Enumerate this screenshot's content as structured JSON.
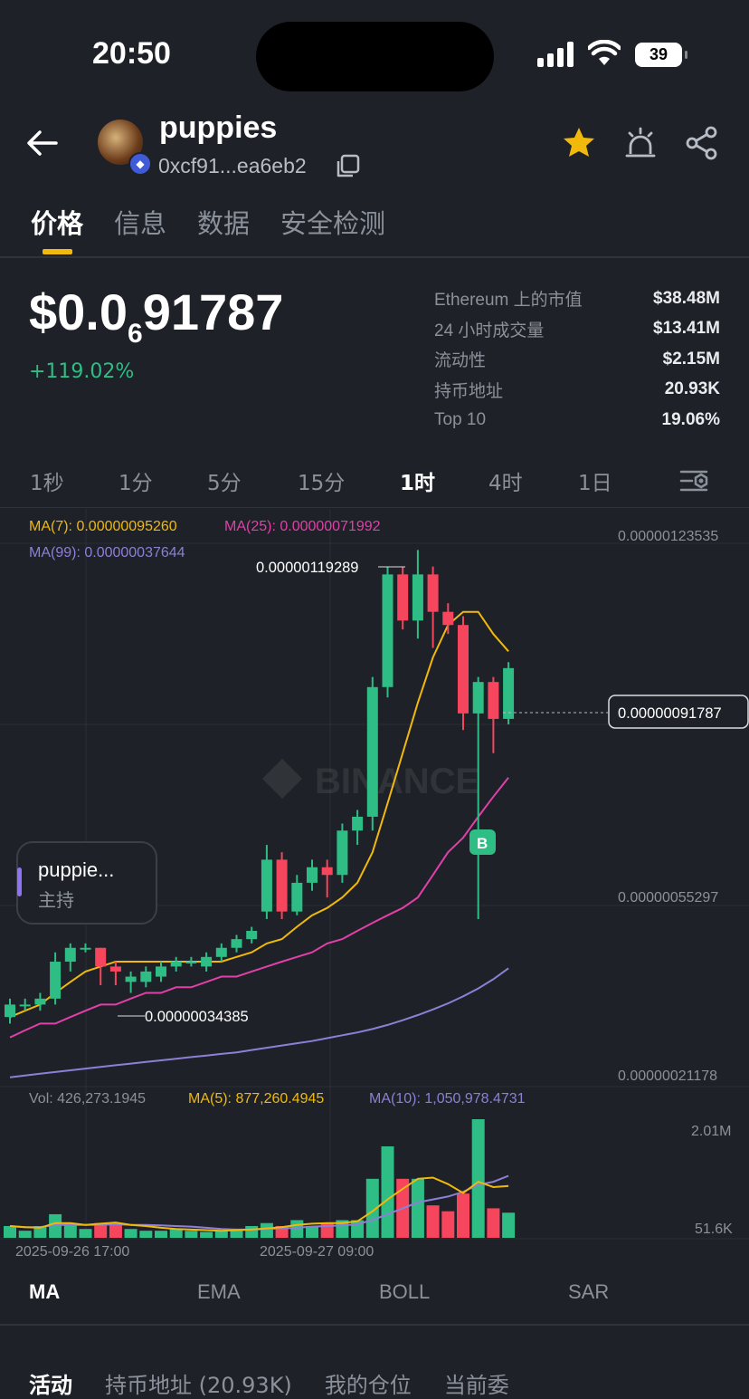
{
  "status_bar": {
    "time": "20:50",
    "battery": "39"
  },
  "header": {
    "token_name": "puppies",
    "token_address": "0xcf91...ea6eb2",
    "icons": [
      "back-arrow-icon",
      "ethereum-icon",
      "copy-icon",
      "star-icon",
      "alarm-icon",
      "share-icon"
    ],
    "star_color": "#f0b90b"
  },
  "tabs": [
    {
      "label": "价格",
      "active": true
    },
    {
      "label": "信息",
      "active": false
    },
    {
      "label": "数据",
      "active": false
    },
    {
      "label": "安全检测",
      "active": false
    }
  ],
  "price": {
    "prefix": "$0.0",
    "zeros": "6",
    "digits": "91787",
    "change": "+119.02%",
    "change_color": "#2ebd85"
  },
  "stats": [
    {
      "label": "Ethereum 上的市值",
      "value": "$38.48M"
    },
    {
      "label": "24 小时成交量",
      "value": "$13.41M"
    },
    {
      "label": "流动性",
      "value": "$2.15M"
    },
    {
      "label": "持币地址",
      "value": "20.93K"
    },
    {
      "label": "Top 10",
      "value": "19.06%"
    }
  ],
  "timeframes": [
    {
      "label": "1秒",
      "active": false
    },
    {
      "label": "1分",
      "active": false
    },
    {
      "label": "5分",
      "active": false
    },
    {
      "label": "15分",
      "active": false
    },
    {
      "label": "1时",
      "active": true
    },
    {
      "label": "4时",
      "active": false
    },
    {
      "label": "1日",
      "active": false
    }
  ],
  "chart_labels": {
    "ma7": "MA(7): 0.00000095260",
    "ma25": "MA(25): 0.00000071992",
    "ma99": "MA(99): 0.00000037644",
    "y_top": "0.00000123535",
    "y_mid": "0.00000055297",
    "y_bot": "0.00000021178",
    "current_price": "0.00000091787",
    "high_label": "0.00000119289",
    "low_label": "0.00000034385",
    "watermark": "BINANCE",
    "buy_marker": "B",
    "vol": "Vol: 426,273.1945",
    "vol_ma5": "MA(5): 877,260.4945",
    "vol_ma10": "MA(10): 1,050,978.4731",
    "vol_top": "2.01M",
    "vol_bot": "51.6K",
    "x1": "2025-09-26 17:00",
    "x2": "2025-09-27 09:00"
  },
  "host_card": {
    "title": "puppie...",
    "subtitle": "主持"
  },
  "indicators": [
    {
      "label": "MA",
      "active": true
    },
    {
      "label": "EMA",
      "active": false
    },
    {
      "label": "BOLL",
      "active": false
    },
    {
      "label": "SAR",
      "active": false
    }
  ],
  "bottom_tabs": [
    {
      "label": "活动",
      "active": true
    },
    {
      "label": "持币地址 (20.93K)",
      "active": false
    },
    {
      "label": "我的仓位",
      "active": false
    },
    {
      "label": "当前委",
      "active": false
    }
  ],
  "colors": {
    "up": "#2ebd85",
    "down": "#f6465d",
    "ma7": "#f0b90b",
    "ma25": "#e040a8",
    "ma99": "#8e7fd6"
  },
  "chart_data": {
    "type": "candlestick",
    "interval": "1h",
    "y_axis_labels": [
      1.23535e-06,
      5.5297e-07,
      2.1178e-07
    ],
    "candles": [
      [
        2.9e-07,
        3.1e-07,
        2.8e-07,
        3.2e-07
      ],
      [
        3.1e-07,
        3.1e-07,
        3e-07,
        3.2e-07
      ],
      [
        3.1e-07,
        3.2e-07,
        3e-07,
        3.3e-07
      ],
      [
        3.2e-07,
        3.9e-07,
        3.1e-07,
        4.1e-07
      ],
      [
        3.9e-07,
        4.2e-07,
        3.7e-07,
        4.3e-07
      ],
      [
        4.2e-07,
        4.2e-07,
        4.1e-07,
        4.3e-07
      ],
      [
        4.2e-07,
        3.8e-07,
        3.4385e-07,
        4.2e-07
      ],
      [
        3.8e-07,
        3.7e-07,
        3.4385e-07,
        3.9e-07
      ],
      [
        3.5e-07,
        3.6e-07,
        3.3e-07,
        3.7e-07
      ],
      [
        3.5e-07,
        3.7e-07,
        3.4e-07,
        3.8e-07
      ],
      [
        3.6e-07,
        3.8e-07,
        3.5e-07,
        3.9e-07
      ],
      [
        3.8e-07,
        3.9e-07,
        3.7e-07,
        4e-07
      ],
      [
        3.9e-07,
        3.9e-07,
        3.8e-07,
        4e-07
      ],
      [
        3.8e-07,
        4e-07,
        3.7e-07,
        4.1e-07
      ],
      [
        4e-07,
        4.2e-07,
        3.9e-07,
        4.3e-07
      ],
      [
        4.2e-07,
        4.4e-07,
        4.1e-07,
        4.5e-07
      ],
      [
        4.4e-07,
        4.6e-07,
        4.3e-07,
        4.7e-07
      ],
      [
        5.1e-07,
        6e-07,
        4.9e-07,
        6.2e-07
      ],
      [
        6e-07,
        5.1e-07,
        4.9e-07,
        6.1e-07
      ],
      [
        5.1e-07,
        5.7e-07,
        5e-07,
        5.8e-07
      ],
      [
        5.7e-07,
        5.9e-07,
        5.6e-07,
        6e-07
      ],
      [
        5.9e-07,
        5.8e-07,
        5.5e-07,
        6e-07
      ],
      [
        5.8e-07,
        6.4e-07,
        5.7e-07,
        6.5e-07
      ],
      [
        6.4e-07,
        6.6e-07,
        6.2e-07,
        6.7e-07
      ],
      [
        6.6e-07,
        8.8e-07,
        6.4e-07,
        9e-07
      ],
      [
        8.8e-07,
        1.13e-06,
        8.6e-07,
        1.15e-06
      ],
      [
        1.13e-06,
        1.02e-06,
        1e-06,
        1.15e-06
      ],
      [
        1.02e-06,
        1.13e-06,
        9.8e-07,
        1.19289e-06
      ],
      [
        1.13e-06,
        1.04e-06,
        9.6e-07,
        1.15e-06
      ],
      [
        1.04e-06,
        1.01e-06,
        9.9e-07,
        1.06e-06
      ],
      [
        1.01e-06,
        8.3e-07,
        8e-07,
        1.03e-06
      ],
      [
        8.3e-07,
        8.9e-07,
        4.9e-07,
        9e-07
      ],
      [
        8.9e-07,
        8.2e-07,
        7.6e-07,
        9e-07
      ],
      [
        8.2e-07,
        9.1787e-07,
        8.1e-07,
        9.3e-07
      ]
    ],
    "ma7": [
      2.9e-07,
      3e-07,
      3.1e-07,
      3.3e-07,
      3.5e-07,
      3.7e-07,
      3.8e-07,
      3.9e-07,
      3.9e-07,
      3.9e-07,
      3.9e-07,
      3.9e-07,
      3.9e-07,
      3.9e-07,
      3.9e-07,
      4e-07,
      4.1e-07,
      4.3e-07,
      4.4e-07,
      4.7e-07,
      5e-07,
      5.2e-07,
      5.5e-07,
      5.7e-07,
      6.1e-07,
      6.8e-07,
      7.6e-07,
      8.5e-07,
      9.4e-07,
      1.01e-06,
      1.04e-06,
      1.04e-06,
      9.9e-07,
      9.526e-07
    ],
    "ma25": [
      2.6e-07,
      2.7e-07,
      2.8e-07,
      2.8e-07,
      2.9e-07,
      3e-07,
      3.1e-07,
      3.1e-07,
      3.2e-07,
      3.3e-07,
      3.3e-07,
      3.4e-07,
      3.4e-07,
      3.5e-07,
      3.6e-07,
      3.6e-07,
      3.7e-07,
      3.8e-07,
      3.9e-07,
      4e-07,
      4.1e-07,
      4.3e-07,
      4.4e-07,
      4.6e-07,
      4.8e-07,
      5e-07,
      5.2e-07,
      5.5e-07,
      5.8e-07,
      6.1e-07,
      6.3e-07,
      6.6e-07,
      6.9e-07,
      7.1992e-07
    ],
    "ma99": [
      2.1e-07,
      2.12e-07,
      2.14e-07,
      2.16e-07,
      2.18e-07,
      2.2e-07,
      2.22e-07,
      2.24e-07,
      2.26e-07,
      2.28e-07,
      2.3e-07,
      2.32e-07,
      2.34e-07,
      2.36e-07,
      2.38e-07,
      2.4e-07,
      2.43e-07,
      2.46e-07,
      2.49e-07,
      2.52e-07,
      2.55e-07,
      2.59e-07,
      2.63e-07,
      2.67e-07,
      2.72e-07,
      2.78e-07,
      2.85e-07,
      2.93e-07,
      3.02e-07,
      3.12e-07,
      3.24e-07,
      3.38e-07,
      3.55e-07,
      3.7644e-07
    ],
    "volume": [
      0.2,
      0.12,
      0.2,
      0.4,
      0.25,
      0.15,
      0.25,
      0.25,
      0.15,
      0.12,
      0.12,
      0.15,
      0.12,
      0.1,
      0.12,
      0.15,
      0.2,
      0.25,
      0.2,
      0.3,
      0.2,
      0.25,
      0.3,
      0.3,
      1.0,
      1.55,
      1.0,
      1.0,
      0.55,
      0.45,
      0.75,
      2.01,
      0.5,
      0.426
    ],
    "volume_ma5": [
      0.2,
      0.18,
      0.17,
      0.25,
      0.25,
      0.22,
      0.24,
      0.26,
      0.22,
      0.2,
      0.17,
      0.15,
      0.14,
      0.13,
      0.12,
      0.13,
      0.14,
      0.16,
      0.18,
      0.22,
      0.24,
      0.25,
      0.25,
      0.28,
      0.45,
      0.65,
      0.83,
      1.0,
      1.02,
      0.91,
      0.76,
      0.95,
      0.86,
      0.877
    ],
    "volume_ma10": [
      0.2,
      0.18,
      0.18,
      0.22,
      0.22,
      0.22,
      0.22,
      0.23,
      0.22,
      0.22,
      0.21,
      0.2,
      0.19,
      0.17,
      0.15,
      0.14,
      0.14,
      0.15,
      0.16,
      0.17,
      0.19,
      0.2,
      0.21,
      0.23,
      0.3,
      0.4,
      0.5,
      0.6,
      0.65,
      0.7,
      0.78,
      0.9,
      0.95,
      1.051
    ],
    "buy_marker_index": 31
  }
}
